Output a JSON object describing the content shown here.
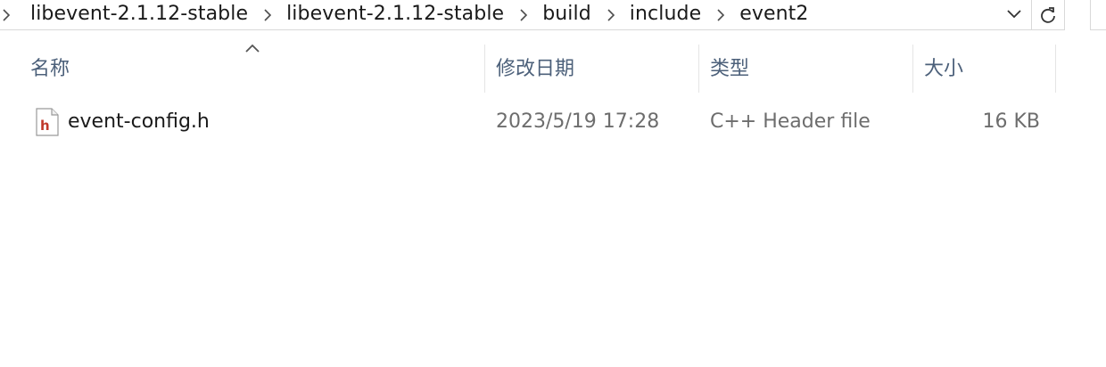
{
  "breadcrumb": {
    "items": [
      {
        "label": "libevent-2.1.12-stable"
      },
      {
        "label": "libevent-2.1.12-stable"
      },
      {
        "label": "build"
      },
      {
        "label": "include"
      },
      {
        "label": "event2"
      }
    ]
  },
  "columns": {
    "name": "名称",
    "date_modified": "修改日期",
    "type": "类型",
    "size": "大小"
  },
  "sort": {
    "column": "name",
    "direction": "ascending"
  },
  "files": [
    {
      "name": "event-config.h",
      "date_modified": "2023/5/19 17:28",
      "type": "C++ Header file",
      "size": "16 KB",
      "icon": "header-file-icon"
    }
  ],
  "colors": {
    "header_text": "#4c607a",
    "secondary_text": "#6d6d6d",
    "icon_accent": "#c0392b"
  }
}
